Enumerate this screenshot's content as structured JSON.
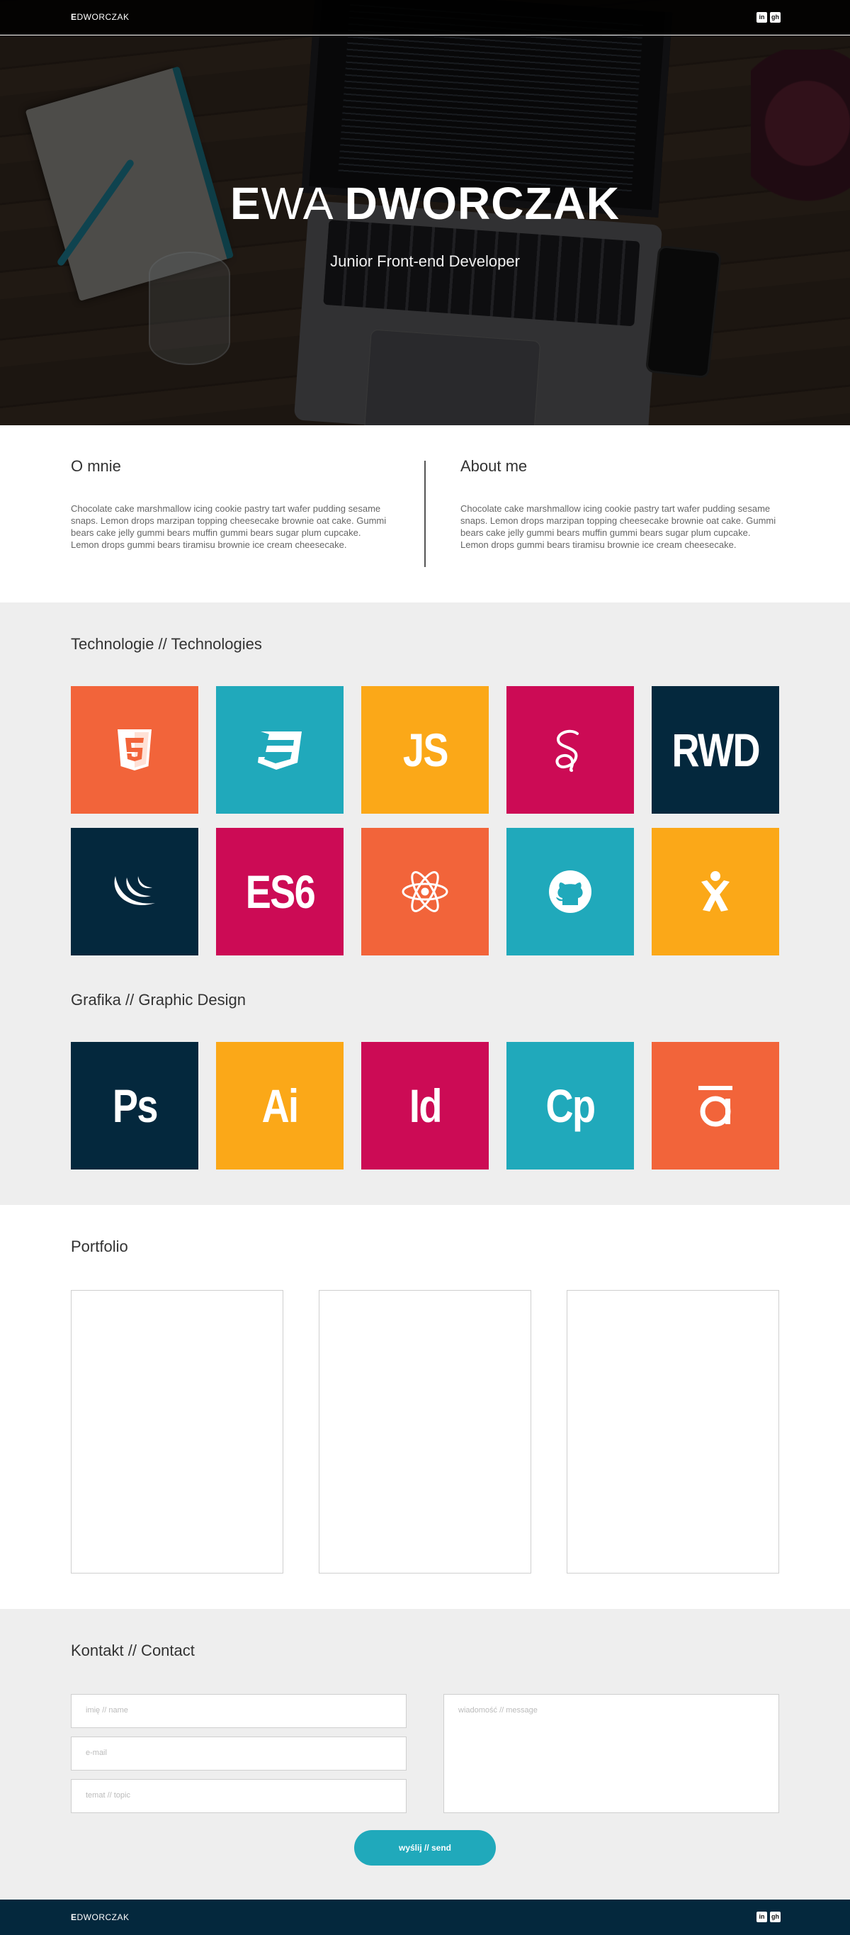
{
  "nav": {
    "logo_initial": "E",
    "logo_rest": "DWORCZAK",
    "social": [
      {
        "icon": "linkedin-icon",
        "label": "in"
      },
      {
        "icon": "github-icon",
        "label": "gh"
      }
    ]
  },
  "hero": {
    "first_initial": "E",
    "first_rest": "WA",
    "last": "DWORCZAK",
    "subtitle": "Junior Front-end Developer"
  },
  "about": {
    "pl_title": "O mnie",
    "pl_text": "Chocolate cake marshmallow icing cookie pastry tart wafer pudding sesame snaps. Lemon drops marzipan topping cheesecake brownie oat cake. Gummi bears cake jelly gummi bears muffin gummi bears sugar plum cupcake. Lemon drops gummi bears tiramisu brownie ice cream cheesecake.",
    "en_title": "About me",
    "en_text": "Chocolate cake marshmallow icing cookie pastry tart wafer pudding sesame snaps. Lemon drops marzipan topping cheesecake brownie oat cake. Gummi bears cake jelly gummi bears muffin gummi bears sugar plum cupcake. Lemon drops gummi bears tiramisu brownie ice cream cheesecake."
  },
  "technologies": {
    "title": "Technologie // Technologies",
    "tiles": [
      {
        "icon": "html5-icon",
        "color": "#f2643a"
      },
      {
        "icon": "css3-icon",
        "color": "#20a9bb"
      },
      {
        "text": "JS",
        "color": "#fba818"
      },
      {
        "icon": "sass-icon",
        "color": "#cc0b55"
      },
      {
        "text": "RWD",
        "color": "#04283d"
      },
      {
        "icon": "jquery-icon",
        "color": "#04283d"
      },
      {
        "text": "ES6",
        "color": "#cc0b55"
      },
      {
        "icon": "react-icon",
        "color": "#f2643a"
      },
      {
        "icon": "github-icon",
        "color": "#20a9bb"
      },
      {
        "icon": "jasmine-icon",
        "color": "#fba818"
      }
    ]
  },
  "graphic": {
    "title": "Grafika // Graphic Design",
    "tiles": [
      {
        "text": "Ps",
        "color": "#04283d"
      },
      {
        "text": "Ai",
        "color": "#fba818"
      },
      {
        "text": "Id",
        "color": "#cc0b55"
      },
      {
        "text": "Cp",
        "color": "#20a9bb"
      },
      {
        "icon": "ae-a-icon",
        "color": "#f2643a"
      }
    ]
  },
  "portfolio": {
    "title": "Portfolio"
  },
  "contact": {
    "title": "Kontakt // Contact",
    "name_placeholder": "imię // name",
    "email_placeholder": "e-mail",
    "topic_placeholder": "temat // topic",
    "message_placeholder": "wiadomość // message",
    "send_label": "wyślij // send"
  },
  "footer": {
    "logo_initial": "E",
    "logo_rest": "DWORCZAK"
  }
}
